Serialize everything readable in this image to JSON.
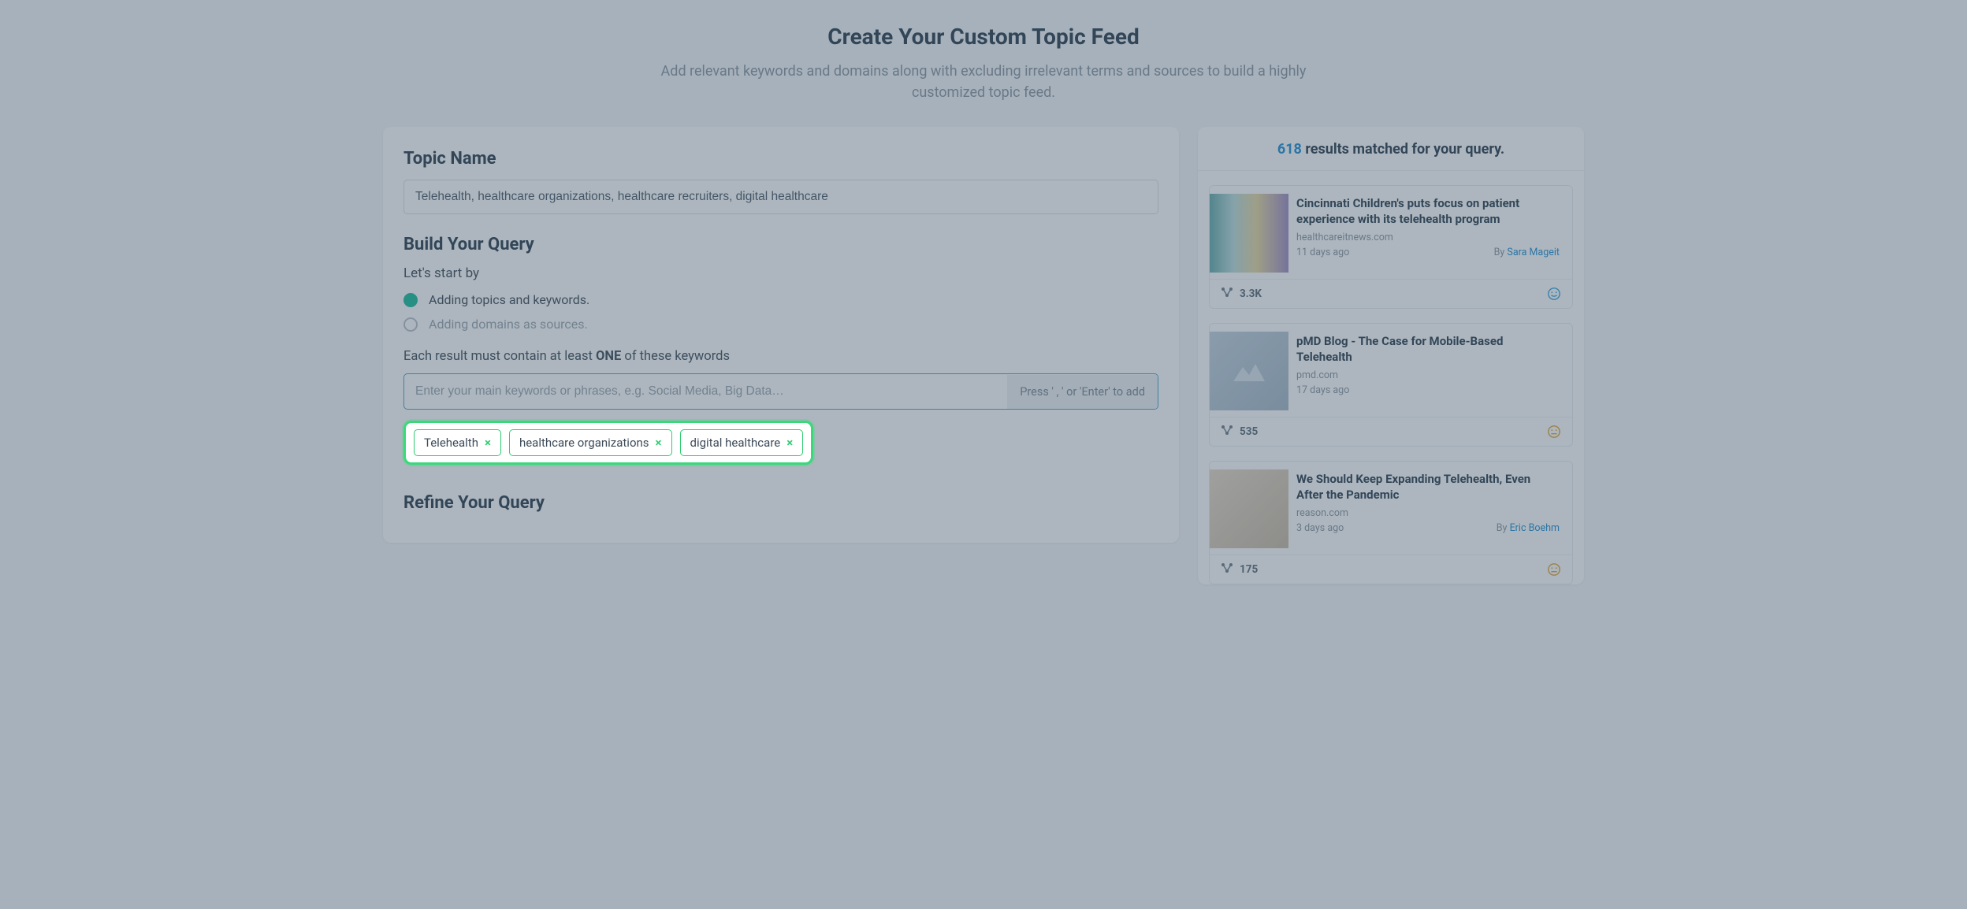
{
  "header": {
    "title": "Create Your Custom Topic Feed",
    "subtitle": "Add relevant keywords and domains along with excluding irrelevant terms and sources to build a highly customized topic feed."
  },
  "topic_name": {
    "label": "Topic Name",
    "value": "Telehealth, healthcare organizations, healthcare recruiters, digital healthcare"
  },
  "build_query": {
    "label": "Build Your Query",
    "prompt": "Let's start by",
    "options": [
      {
        "label": "Adding topics and keywords.",
        "selected": true
      },
      {
        "label": "Adding domains as sources.",
        "selected": false
      }
    ],
    "kw_instruction_prefix": "Each result must contain at least ",
    "kw_instruction_strong": "ONE",
    "kw_instruction_suffix": " of these keywords",
    "kw_placeholder": "Enter your main keywords or phrases, e.g. Social Media, Big Data…",
    "kw_hint": "Press ' , ' or 'Enter' to add",
    "tags": [
      "Telehealth",
      "healthcare organizations",
      "digital healthcare"
    ]
  },
  "refine": {
    "label": "Refine Your Query"
  },
  "results": {
    "count": "618",
    "suffix": " results matched for your query.",
    "cards": [
      {
        "title": "Cincinnati Children's puts focus on patient experience with its telehealth program",
        "source": "healthcareitnews.com",
        "age": "11 days ago",
        "by_prefix": "By ",
        "author": "Sara Mageit",
        "stat": "3.3K",
        "face": "happy"
      },
      {
        "title": "pMD Blog - The Case for Mobile-Based Telehealth",
        "source": "pmd.com",
        "age": "17 days ago",
        "by_prefix": "",
        "author": "",
        "stat": "535",
        "face": "warn"
      },
      {
        "title": "We Should Keep Expanding Telehealth, Even After the Pandemic",
        "source": "reason.com",
        "age": "3 days ago",
        "by_prefix": "By ",
        "author": "Eric Boehm",
        "stat": "175",
        "face": "warn"
      }
    ]
  }
}
